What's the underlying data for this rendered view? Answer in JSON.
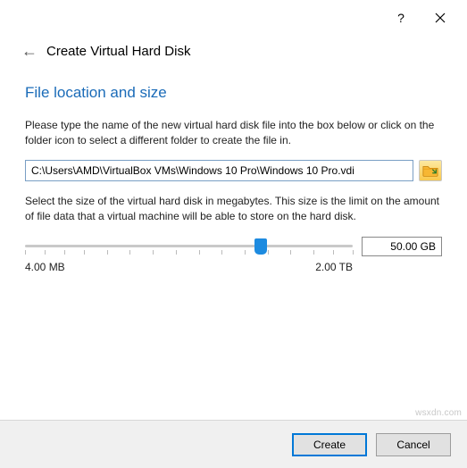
{
  "window": {
    "title": "Create Virtual Hard Disk"
  },
  "section": {
    "heading": "File location and size",
    "desc_location": "Please type the name of the new virtual hard disk file into the box below or click on the folder icon to select a different folder to create the file in.",
    "desc_size": "Select the size of the virtual hard disk in megabytes. This size is the limit on the amount of file data that a virtual machine will be able to store on the hard disk."
  },
  "fields": {
    "path_value": "C:\\Users\\AMD\\VirtualBox VMs\\Windows 10 Pro\\Windows 10 Pro.vdi",
    "size_value": "50.00 GB",
    "slider_min_label": "4.00 MB",
    "slider_max_label": "2.00 TB",
    "slider_position_pct": 72
  },
  "buttons": {
    "create": "Create",
    "cancel": "Cancel"
  },
  "watermark": "wsxdn.com"
}
